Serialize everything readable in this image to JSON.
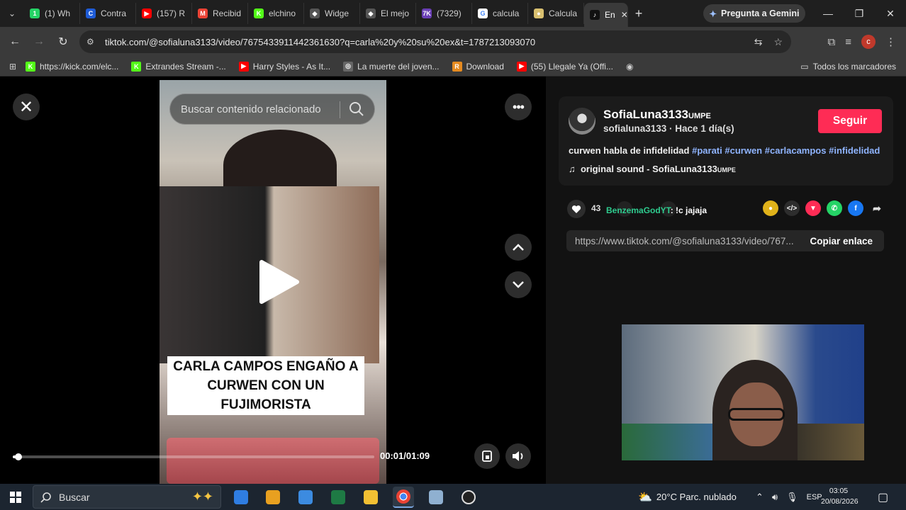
{
  "browser": {
    "tabs": [
      {
        "label": "(1) Wh",
        "fav_bg": "#25d366",
        "fav_text": "1"
      },
      {
        "label": "Contra",
        "fav_bg": "#1e5bd6",
        "fav_text": "C"
      },
      {
        "label": "(157) R",
        "fav_bg": "#ff0000",
        "fav_text": "▶"
      },
      {
        "label": "Recibid",
        "fav_bg": "#ea4335",
        "fav_text": "M"
      },
      {
        "label": "elchino",
        "fav_bg": "#53fc18",
        "fav_text": "K"
      },
      {
        "label": "Widge",
        "fav_bg": "#555",
        "fav_text": "◆"
      },
      {
        "label": "El mejo",
        "fav_bg": "#555",
        "fav_text": "◆"
      },
      {
        "label": "(7329)",
        "fav_bg": "#6a3fb5",
        "fav_text": "7K"
      },
      {
        "label": "calcula",
        "fav_bg": "#ffffff",
        "fav_text": "G"
      },
      {
        "label": "Calcula",
        "fav_bg": "#d9c070",
        "fav_text": "●"
      },
      {
        "label": "En",
        "fav_bg": "#111",
        "fav_text": "♪",
        "active": true
      }
    ],
    "gemini_label": "Pregunta a Gemini",
    "url": "tiktok.com/@sofialuna3133/video/7675433911442361630?q=carla%20y%20su%20ex&t=1787213093070",
    "profile_initial": "c",
    "bookmarks": [
      {
        "label": "https://kick.com/elc...",
        "bg": "#53fc18",
        "icon": "K"
      },
      {
        "label": "Extrandes Stream -...",
        "bg": "#53fc18",
        "icon": "K"
      },
      {
        "label": "Harry Styles - As It...",
        "bg": "#ff0000",
        "icon": "▶"
      },
      {
        "label": "La muerte del joven...",
        "bg": "#666",
        "icon": "◎"
      },
      {
        "label": "Download",
        "bg": "#e58a1f",
        "icon": "R"
      },
      {
        "label": "(55) Llegale Ya (Offi...",
        "bg": "#ff0000",
        "icon": "▶"
      }
    ],
    "all_bookmarks": "Todos los marcadores"
  },
  "player": {
    "search_placeholder": "Buscar contenido relacionado",
    "caption_lines": [
      "CARLA CAMPOS ENGAÑO A",
      "CURWEN CON UN",
      "FUJIMORISTA"
    ],
    "timecode": "00:01/01:09",
    "progress": 0.015
  },
  "post": {
    "username": "SofiaLuna3133",
    "username_suffix": "UMPE",
    "handle_line": "sofialuna3133 · Hace 1 día(s)",
    "follow_label": "Seguir",
    "description": "curwen habla de infidelidad",
    "hashtags": [
      "#parati",
      "#curwen",
      "#carlacampos",
      "#infidelidad"
    ],
    "sound": "original sound - SofiaLuna3133",
    "sound_suffix": "UMPE",
    "likes": "43",
    "comment_overlay_user": "BenzemaGodYT",
    "comment_overlay_text": ": !c jajaja",
    "link": "https://www.tiktok.com/@sofialuna3133/video/767...",
    "copy_label": "Copiar enlace"
  },
  "taskbar": {
    "search_label": "Buscar",
    "weather": "20°C  Parc. nublado",
    "lang": "ESP",
    "time": "03:05",
    "date": "20/08/2026"
  },
  "colors": {
    "accent_follow": "#fe2c55",
    "hashtag": "#8fb4ff",
    "comment_user": "#2ecc8f"
  }
}
